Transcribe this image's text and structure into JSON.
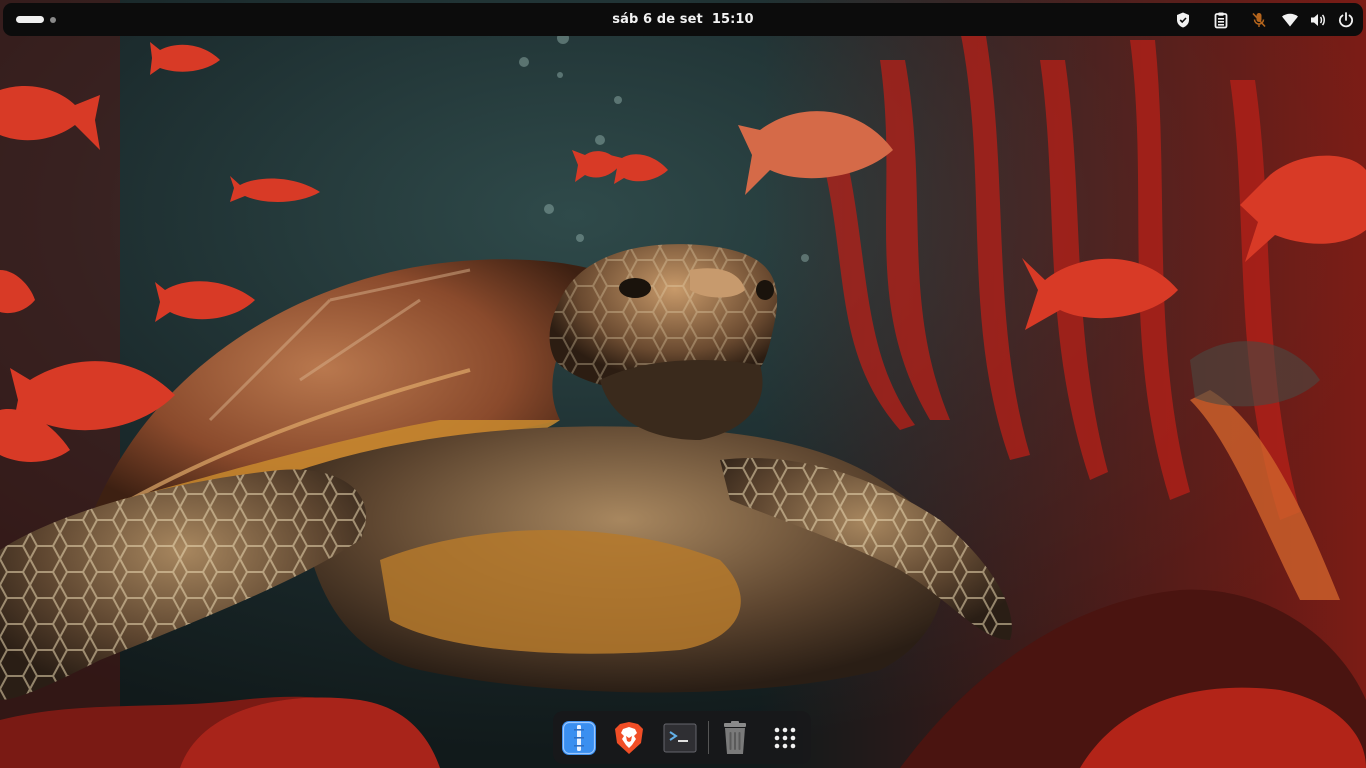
{
  "topbar": {
    "date": "sáb 6 de set",
    "time": "15:10",
    "tray_icons": [
      "shield-icon",
      "clipboard-icon",
      "microphone-muted-icon",
      "wifi-icon",
      "volume-icon",
      "power-icon"
    ]
  },
  "dock": {
    "items": [
      {
        "name": "files-app-icon"
      },
      {
        "name": "brave-browser-icon"
      },
      {
        "name": "terminal-icon"
      },
      {
        "name": "trash-icon"
      },
      {
        "name": "show-apps-icon"
      }
    ]
  },
  "colors": {
    "topbar_bg": "#0c0c0c",
    "dock_bg": "#18181a",
    "files_blue": "#3a8ff0",
    "brave_orange": "#f14e26"
  }
}
